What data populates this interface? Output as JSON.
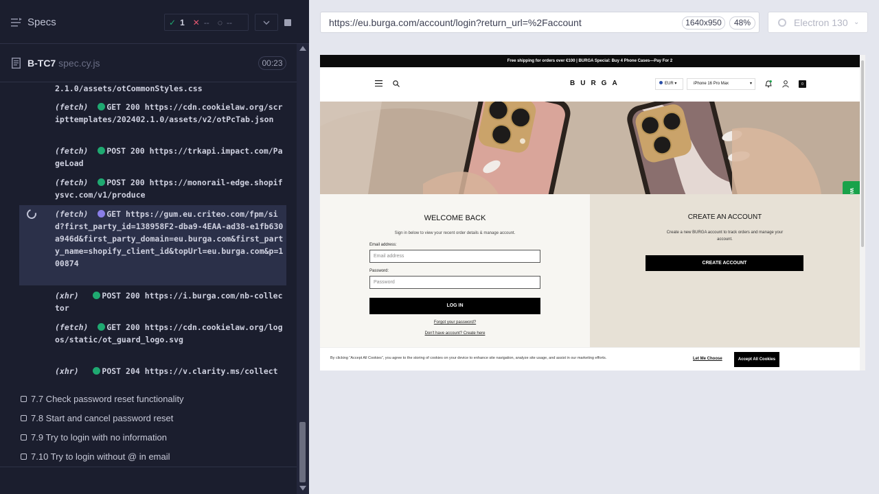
{
  "runner": {
    "specs_label": "Specs",
    "stats": {
      "passed": "1",
      "failed": "--",
      "pending": "--"
    },
    "file": {
      "name": "B-TC7",
      "ext": "spec.cy.js",
      "time": "00:23"
    },
    "log": [
      {
        "text": "2.1.0/assets/otCommonStyles.css"
      },
      {
        "type": "(fetch)",
        "method": "GET 200",
        "url": "https://cdn.cookielaw.org/scripttemplates/202402.1.0/assets/v2/otPcTab.json"
      },
      {
        "type": "(fetch)",
        "method": "POST 200",
        "url": "https://trkapi.impact.com/PageLoad"
      },
      {
        "type": "(fetch)",
        "method": "POST 200",
        "url": "https://monorail-edge.shopifysvc.com/v1/produce"
      },
      {
        "type": "(fetch)",
        "method": "GET",
        "url": "https://gum.eu.criteo.com/fpm/sid?first_party_id=138958F2-dba9-4EAA-ad38-e1fb630a946d&first_party_domain=eu.burga.com&first_party_name=shopify_client_id&topUrl=eu.burga.com&p=100874"
      },
      {
        "type": "(xhr)",
        "method": "POST 200",
        "url": "https://i.burga.com/nb-collector"
      },
      {
        "type": "(fetch)",
        "method": "GET 200",
        "url": "https://cdn.cookielaw.org/logos/static/ot_guard_logo.svg"
      },
      {
        "type": "(xhr)",
        "method": "POST 204",
        "url": "https://v.clarity.ms/collect"
      }
    ],
    "tests": [
      "7.7 Check password reset functionality",
      "7.8 Start and cancel password reset",
      "7.9 Try to login with no information",
      "7.10 Try to login without @ in email"
    ]
  },
  "browser": {
    "url": "https://eu.burga.com/account/login?return_url=%2Faccount",
    "viewport_size": "1640x950",
    "zoom": "48%",
    "engine": "Electron 130"
  },
  "site": {
    "announcement": "Free shipping for orders over €100  |  BURGA Special: Buy 4 Phone Cases—Pay For 2",
    "logo": "BURGA",
    "currency": "EUR",
    "device": "iPhone 16 Pro Max",
    "cart_count": "0",
    "feedback_tab": "Win",
    "login": {
      "title": "WELCOME BACK",
      "subtitle": "Sign in below to view your recent order details & manage account.",
      "email_label": "Email address:",
      "email_placeholder": "Email address",
      "password_label": "Password:",
      "password_placeholder": "Password",
      "button": "LOG IN",
      "forgot": "Forgot your password?",
      "no_account": "Don't have account? Create here"
    },
    "register": {
      "title": "CREATE AN ACCOUNT",
      "subtitle": "Create a new BURGA account to track orders and manage your account.",
      "button": "CREATE ACCOUNT"
    },
    "cookie": {
      "text": "By clicking “Accept All Cookies”, you agree to the storing of cookies on your device to enhance site navigation, analyze site usage, and assist in our marketing efforts.",
      "choose": "Let Me Choose",
      "accept": "Accept All Cookies"
    }
  }
}
